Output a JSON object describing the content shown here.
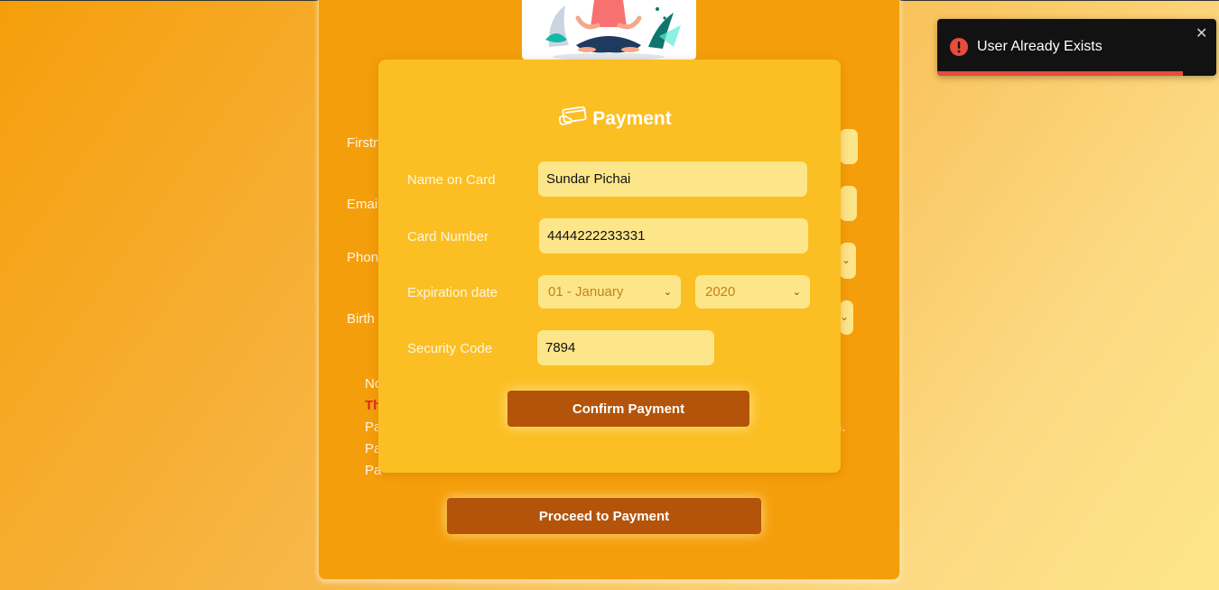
{
  "registration_form": {
    "labels": {
      "firstname": "Firstn",
      "email": "Email",
      "phone": "Phon",
      "birth": "Birth"
    },
    "notes": [
      "No",
      "Th",
      "Pa",
      "Pa",
      "Pa"
    ],
    "note_tail": "n.",
    "proceed_button": "Proceed to Payment"
  },
  "payment_modal": {
    "title": "Payment",
    "title_icon": "credit-card-icon",
    "fields": {
      "name_on_card": {
        "label": "Name on Card",
        "value": "Sundar Pichai"
      },
      "card_number": {
        "label": "Card Number",
        "value": "4444222233331"
      },
      "expiration": {
        "label": "Expiration date",
        "month_selected": "01 - January",
        "year_selected": "2020"
      },
      "security_code": {
        "label": "Security Code",
        "value": "7894"
      }
    },
    "confirm_button": "Confirm Payment"
  },
  "toast": {
    "icon": "error-icon",
    "message": "User Already Exists",
    "close_icon": "close-icon",
    "progress_fraction": 0.88,
    "colors": {
      "background": "#121212",
      "progress": "#e74c3c",
      "icon": "#e74c3c"
    }
  },
  "colors": {
    "page_gradient_start": "#f59e0b",
    "page_gradient_end": "#fde68a",
    "modal_background": "#fbbf24",
    "input_background": "#fde68a",
    "button_brown": "#b4540b"
  }
}
